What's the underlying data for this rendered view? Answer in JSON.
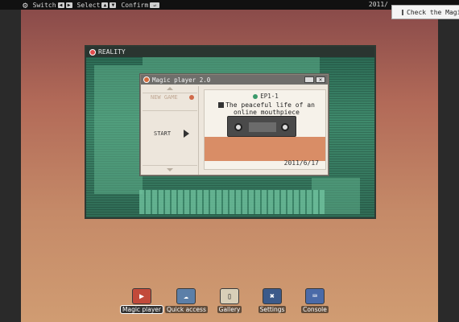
{
  "topbar": {
    "switch_label": "Switch",
    "select_label": "Select",
    "confirm_label": "Confirm",
    "date_partial": "2011/"
  },
  "popup": {
    "label": "Check the Magic"
  },
  "monitor": {
    "title": "REALITY"
  },
  "magic_player": {
    "title": "Magic player 2.0",
    "menu": {
      "new_game": "NEW GAME",
      "start": "START"
    },
    "episode": "EP1-1",
    "song_title": "The peaceful life of an online mouthpiece",
    "date": "2011/6/17"
  },
  "dock": [
    {
      "label": "Magic player",
      "icon": "play-icon",
      "color": "#c24a3a"
    },
    {
      "label": "Quick access",
      "icon": "cloud-icon",
      "color": "#5c7fa8"
    },
    {
      "label": "Gallery",
      "icon": "book-icon",
      "color": "#d8cfb8"
    },
    {
      "label": "Settings",
      "icon": "wrench-icon",
      "color": "#3c5a8a"
    },
    {
      "label": "Console",
      "icon": "console-icon",
      "color": "#4a6aa8"
    }
  ]
}
